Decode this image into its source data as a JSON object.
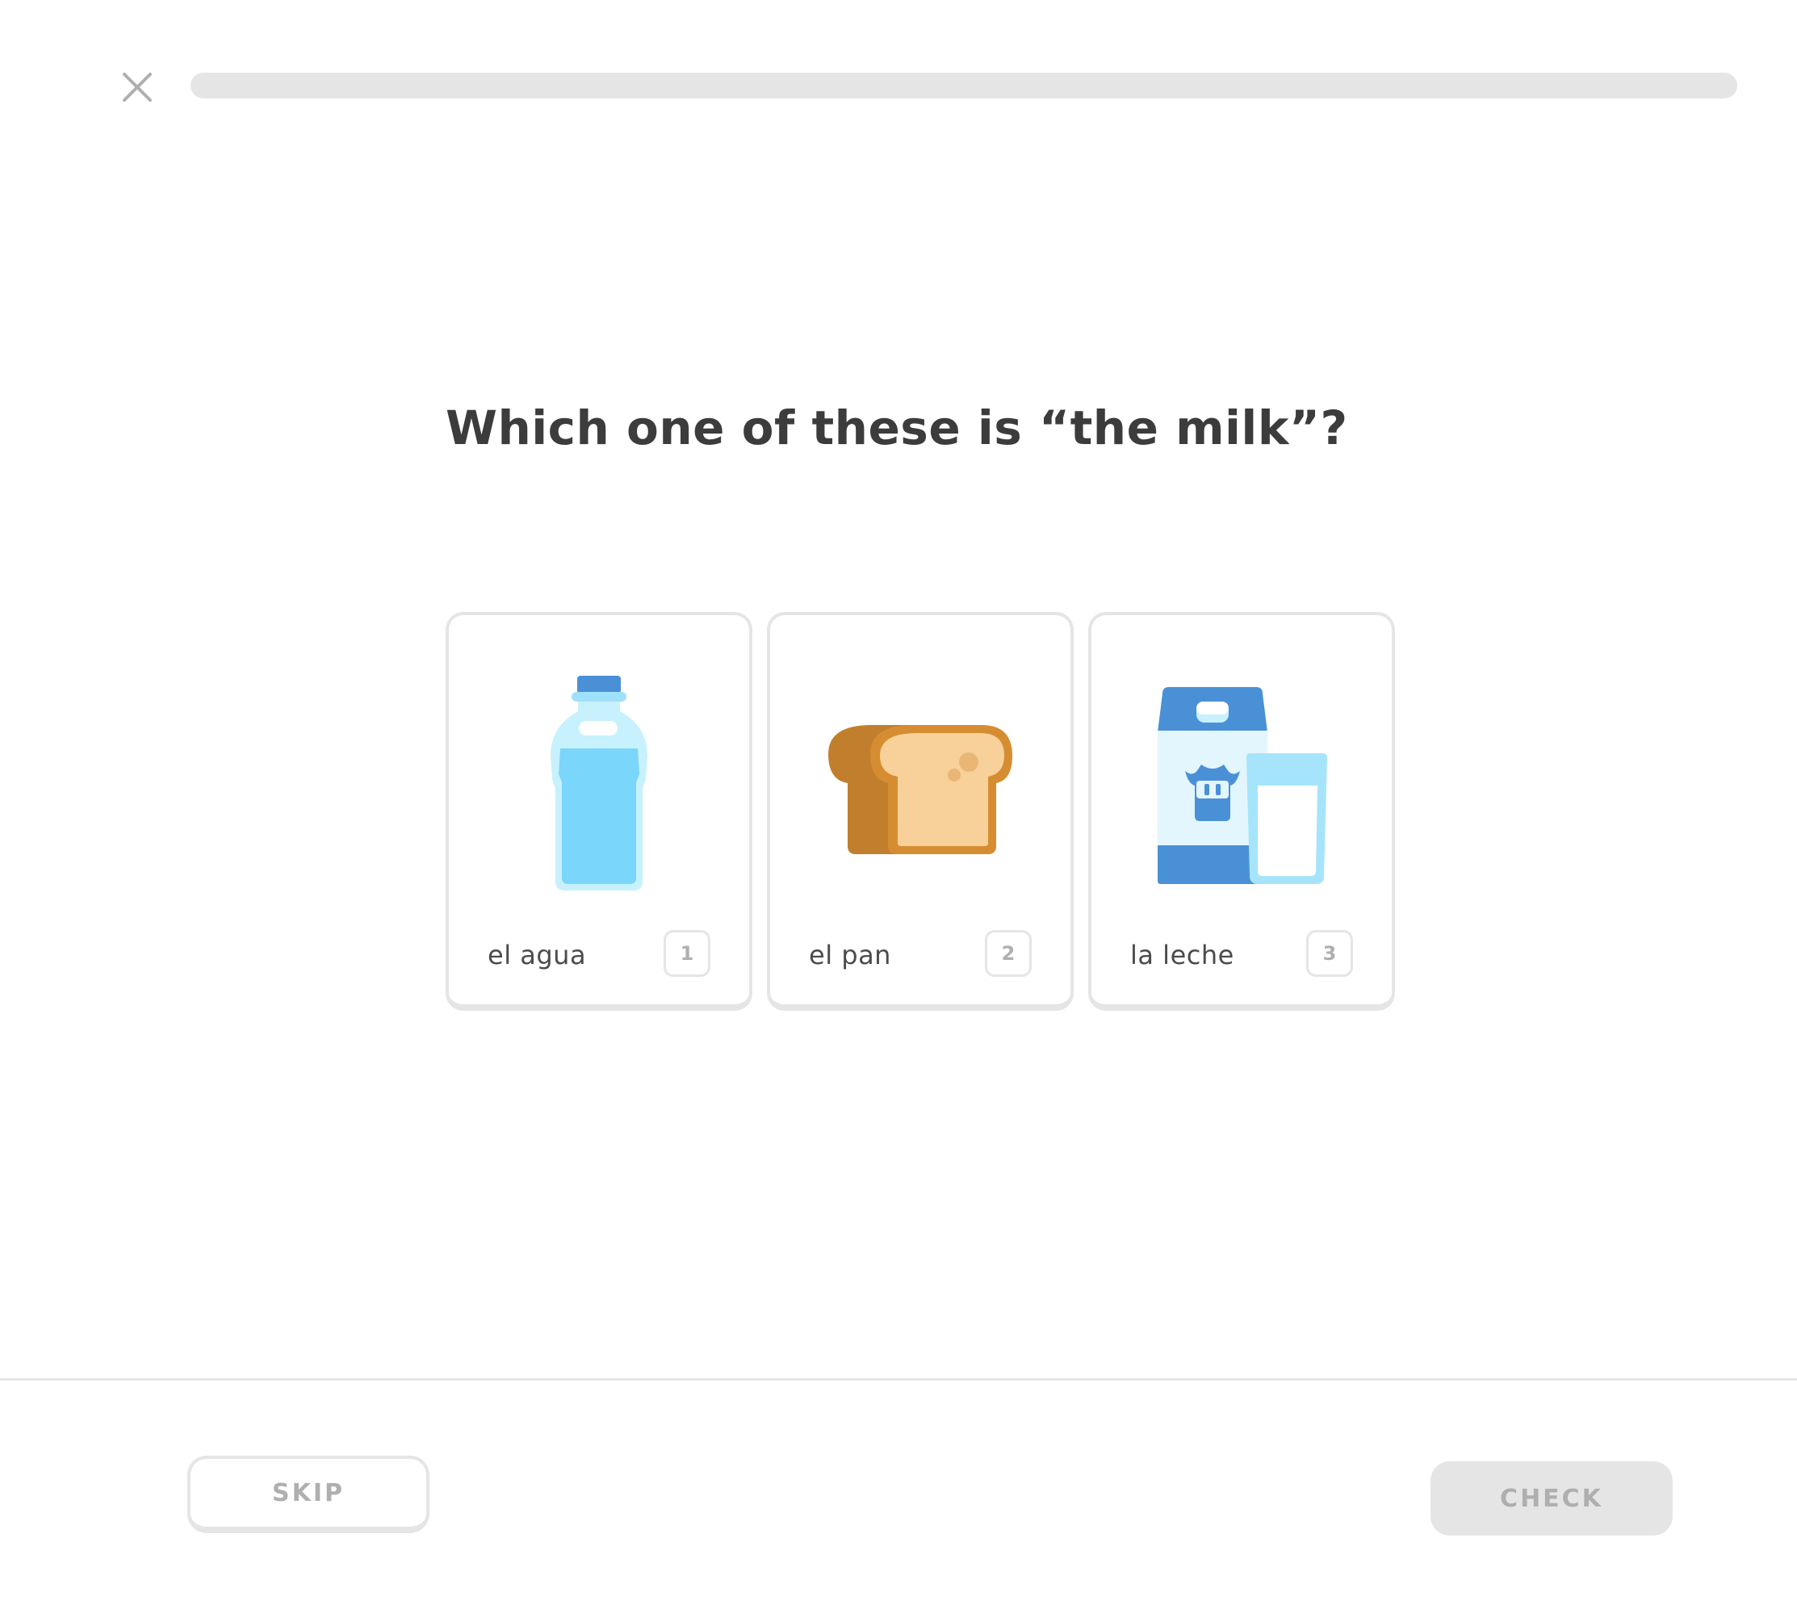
{
  "header": {
    "close_icon": "close-icon",
    "progress_fraction": 0
  },
  "prompt": {
    "text": "Which one of these is “the milk”?"
  },
  "choices": [
    {
      "label": "el agua",
      "key": "1",
      "icon": "water-bottle-icon"
    },
    {
      "label": "el pan",
      "key": "2",
      "icon": "bread-icon"
    },
    {
      "label": "la leche",
      "key": "3",
      "icon": "milk-carton-icon"
    }
  ],
  "footer": {
    "skip_label": "SKIP",
    "check_label": "CHECK"
  },
  "colors": {
    "border": "#e5e5e5",
    "text_dark": "#3c3c3c",
    "text_muted": "#afafaf",
    "progress_track": "#e5e5e5"
  }
}
